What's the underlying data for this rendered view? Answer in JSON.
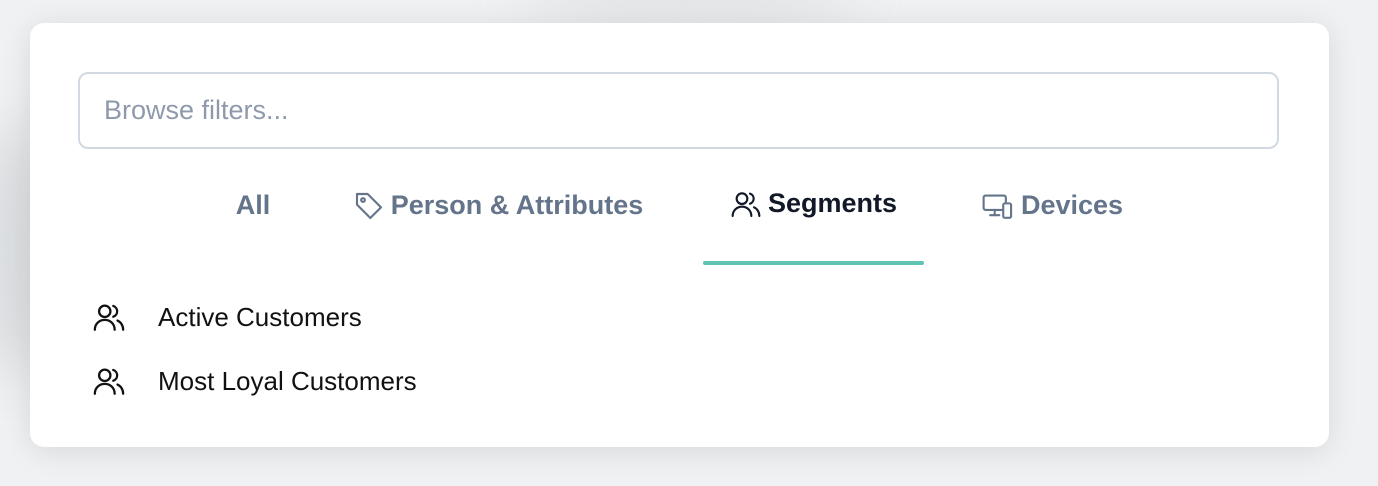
{
  "search": {
    "placeholder": "Browse filters..."
  },
  "tabs": [
    {
      "label": "All",
      "icon": "",
      "active": false
    },
    {
      "label": "Person & Attributes",
      "icon": "tag-icon",
      "active": false
    },
    {
      "label": "Segments",
      "icon": "users-icon",
      "active": true
    },
    {
      "label": "Devices",
      "icon": "devices-icon",
      "active": false
    }
  ],
  "colors": {
    "accent": "#5fc4b4",
    "muted_text": "#64748b",
    "border": "#d2d9e2"
  },
  "segments": [
    {
      "label": "Active Customers",
      "icon": "users-icon"
    },
    {
      "label": "Most Loyal Customers",
      "icon": "users-icon"
    }
  ]
}
